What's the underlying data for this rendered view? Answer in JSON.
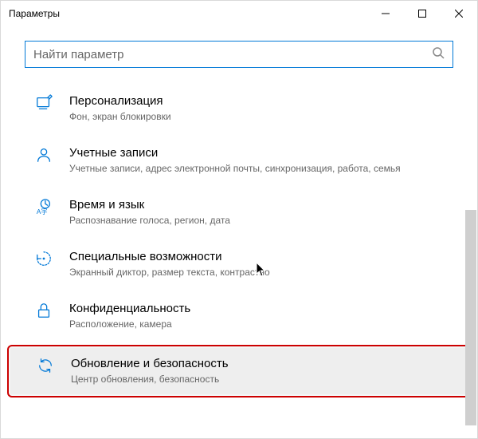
{
  "window": {
    "title": "Параметры"
  },
  "search": {
    "placeholder": "Найти параметр"
  },
  "items": [
    {
      "title": "Персонализация",
      "subtitle": "Фон, экран блокировки"
    },
    {
      "title": "Учетные записи",
      "subtitle": "Учетные записи, адрес электронной почты, синхронизация, работа, семья"
    },
    {
      "title": "Время и язык",
      "subtitle": "Распознавание голоса, регион, дата"
    },
    {
      "title": "Специальные возможности",
      "subtitle": "Экранный диктор, размер текста, контрастно"
    },
    {
      "title": "Конфиденциальность",
      "subtitle": "Расположение, камера"
    },
    {
      "title": "Обновление и безопасность",
      "subtitle": "Центр обновления, безопасность"
    }
  ]
}
